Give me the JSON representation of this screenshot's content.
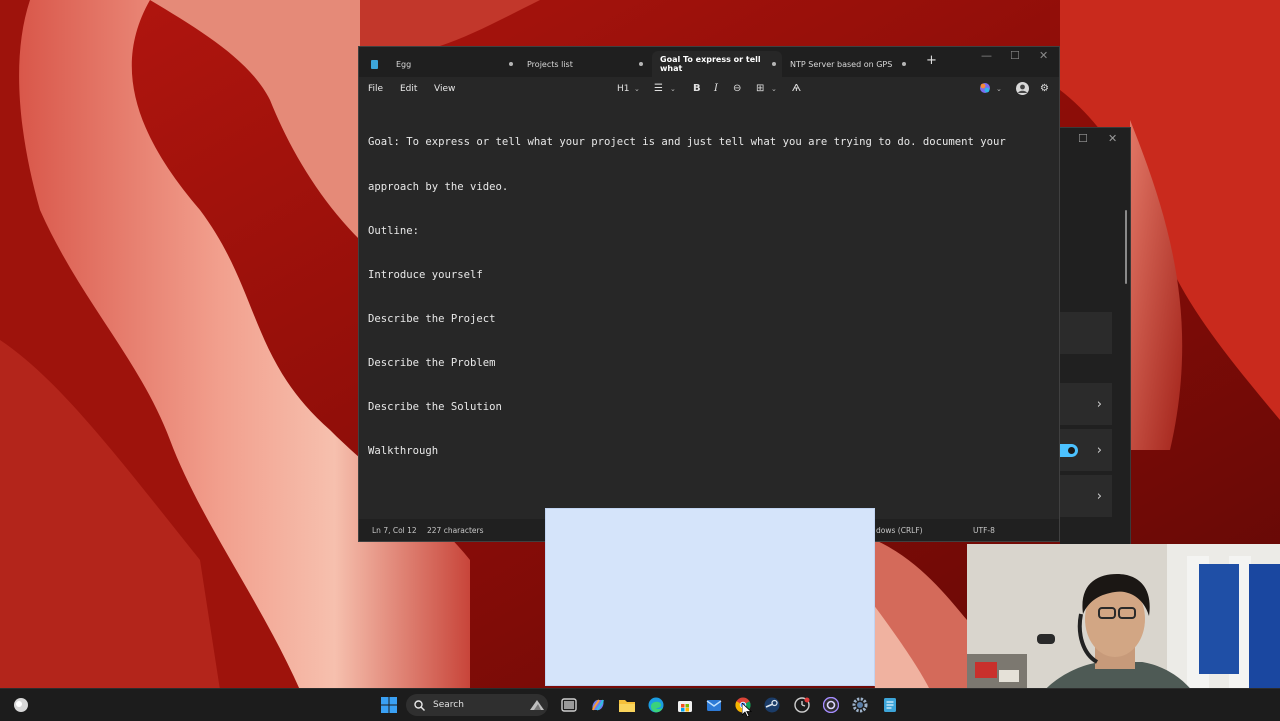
{
  "notepad": {
    "tabs": [
      {
        "label": "Egg",
        "modified": true
      },
      {
        "label": "Projects list",
        "modified": true
      },
      {
        "label": "Goal To express or tell what",
        "modified": true,
        "active": true
      },
      {
        "label": "NTP Server based on GPS",
        "modified": true
      }
    ],
    "menu": {
      "file": "File",
      "edit": "Edit",
      "view": "View"
    },
    "toolbar": {
      "heading": "H1"
    },
    "editor_lines": [
      "Goal: To express or tell what your project is and just tell what you are trying to do. document your",
      "approach by the video.",
      "Outline:",
      "Introduce yourself",
      "Describe the Project",
      "Describe the Problem",
      "Describe the Solution",
      "Walkthrough"
    ],
    "status": {
      "position": "Ln 7, Col 12",
      "characters": "227 characters",
      "line_ending": "dows (CRLF)",
      "encoding": "UTF-8"
    }
  },
  "taskbar": {
    "search_label": "Search",
    "icons": [
      "windows-start-icon",
      "search-icon",
      "task-view-icon",
      "copilot-icon",
      "file-explorer-icon",
      "edge-icon",
      "store-icon",
      "mail-icon",
      "chrome-icon",
      "steam-icon",
      "clock-app-icon",
      "obs-icon",
      "settings-icon",
      "notepad-icon"
    ]
  },
  "colors": {
    "accent": "#4cc2ff",
    "notepad_bg": "#272727",
    "taskbar_bg": "#1c1c1c",
    "overlay": "#d5e4fa"
  }
}
